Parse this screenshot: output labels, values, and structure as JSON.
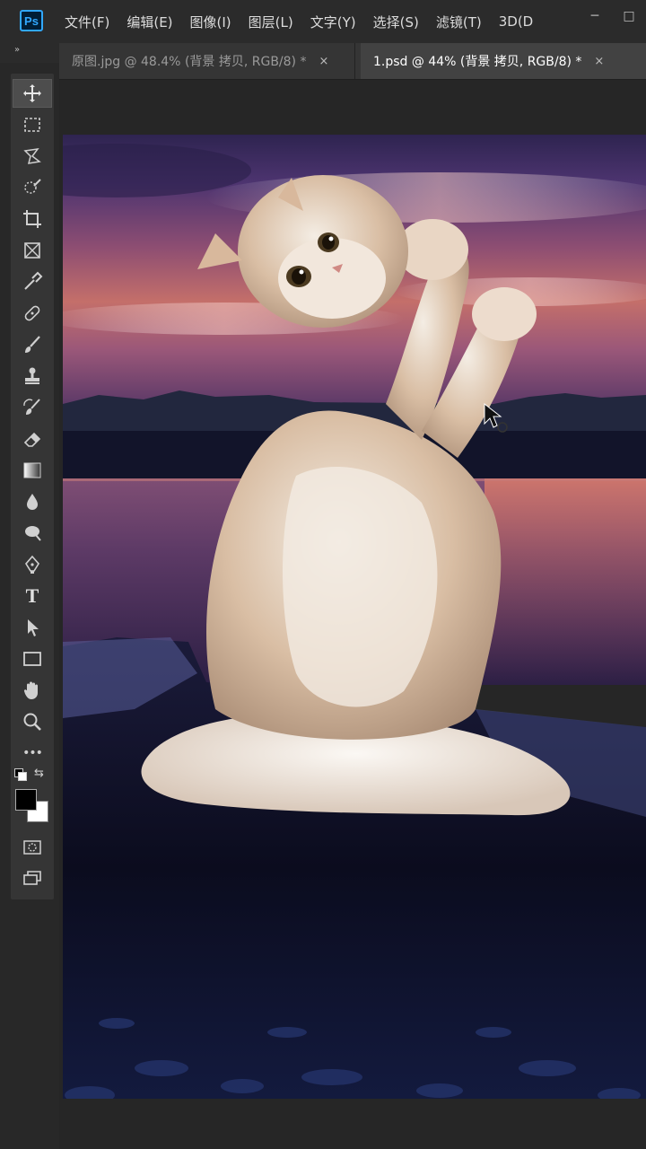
{
  "app": {
    "logo": "Ps"
  },
  "menu": [
    "文件(F)",
    "编辑(E)",
    "图像(I)",
    "图层(L)",
    "文字(Y)",
    "选择(S)",
    "滤镜(T)",
    "3D(D"
  ],
  "window_controls": {
    "minimize": "─",
    "maximize": "□"
  },
  "tabs": [
    {
      "label": "原图.jpg @ 48.4% (背景 拷贝, RGB/8) *",
      "close": "×"
    },
    {
      "label": "1.psd @ 44% (背景 拷贝, RGB/8) *",
      "close": "×"
    }
  ],
  "toolbar": {
    "collapse": "»",
    "tools": [
      "move-tool-icon",
      "marquee-tool-icon",
      "lasso-tool-icon",
      "quick-select-tool-icon",
      "crop-tool-icon",
      "frame-tool-icon",
      "eyedropper-tool-icon",
      "healing-brush-icon",
      "brush-tool-icon",
      "stamp-tool-icon",
      "history-brush-icon",
      "eraser-tool-icon",
      "gradient-tool-icon",
      "blur-tool-icon",
      "dodge-tool-icon",
      "pen-tool-icon",
      "type-tool-icon",
      "path-select-icon",
      "rectangle-tool-icon",
      "hand-tool-icon",
      "zoom-tool-icon",
      "more-tools-icon"
    ],
    "type_glyph": "T",
    "more_glyph": "•••"
  },
  "colors": {
    "foreground": "#000000",
    "background": "#ffffff",
    "accent": "#31a8ff"
  }
}
